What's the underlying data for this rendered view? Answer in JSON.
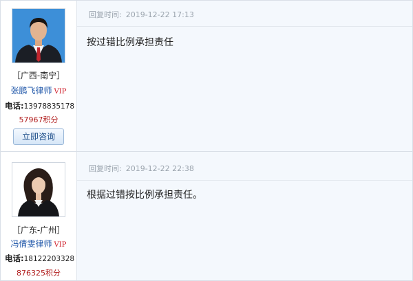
{
  "replies": [
    {
      "lawyer": {
        "region": "［广西-南宁］",
        "name": "张鹏飞律师",
        "vip": "VIP",
        "phone_label": "电话:",
        "phone": "13978835178",
        "points": "57967积分",
        "consult_button": "立即咨询"
      },
      "reply_time_label": "回复时间:",
      "reply_time": "2019-12-22 17:13",
      "message": "按过错比例承担责任"
    },
    {
      "lawyer": {
        "region": "［广东-广州］",
        "name": "冯倩雯律师",
        "vip": "VIP",
        "phone_label": "电话:",
        "phone": "18122203328",
        "points": "876325积分"
      },
      "reply_time_label": "回复时间:",
      "reply_time": "2019-12-22 22:38",
      "message": "根据过错按比例承担责任。"
    }
  ],
  "colors": {
    "content_bg": "#f4f8fd",
    "lawyer_name": "#1d55a8",
    "vip": "#d0202c",
    "points": "#b01b1b",
    "time_text": "#9aa3ad"
  }
}
